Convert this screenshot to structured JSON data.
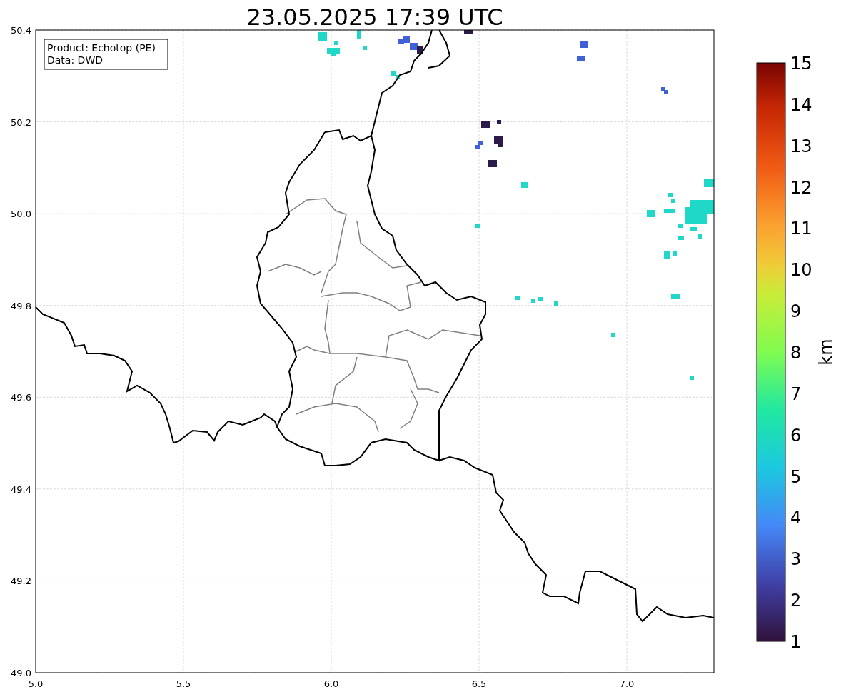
{
  "title": "23.05.2025 17:39 UTC",
  "info_box": [
    "Product: Echotop (PE)",
    "Data: DWD"
  ],
  "x_ticks": [
    "5.0",
    "5.5",
    "6.0",
    "6.5",
    "7.0"
  ],
  "y_ticks": [
    "50.4",
    "50.2",
    "50.0",
    "49.8",
    "49.6",
    "49.4",
    "49.2",
    "49.0"
  ],
  "colorbar": {
    "label": "km",
    "ticks": [
      "15",
      "14",
      "13",
      "12",
      "11",
      "10",
      "9",
      "8",
      "7",
      "6",
      "5",
      "4",
      "3",
      "2",
      "1"
    ]
  }
}
